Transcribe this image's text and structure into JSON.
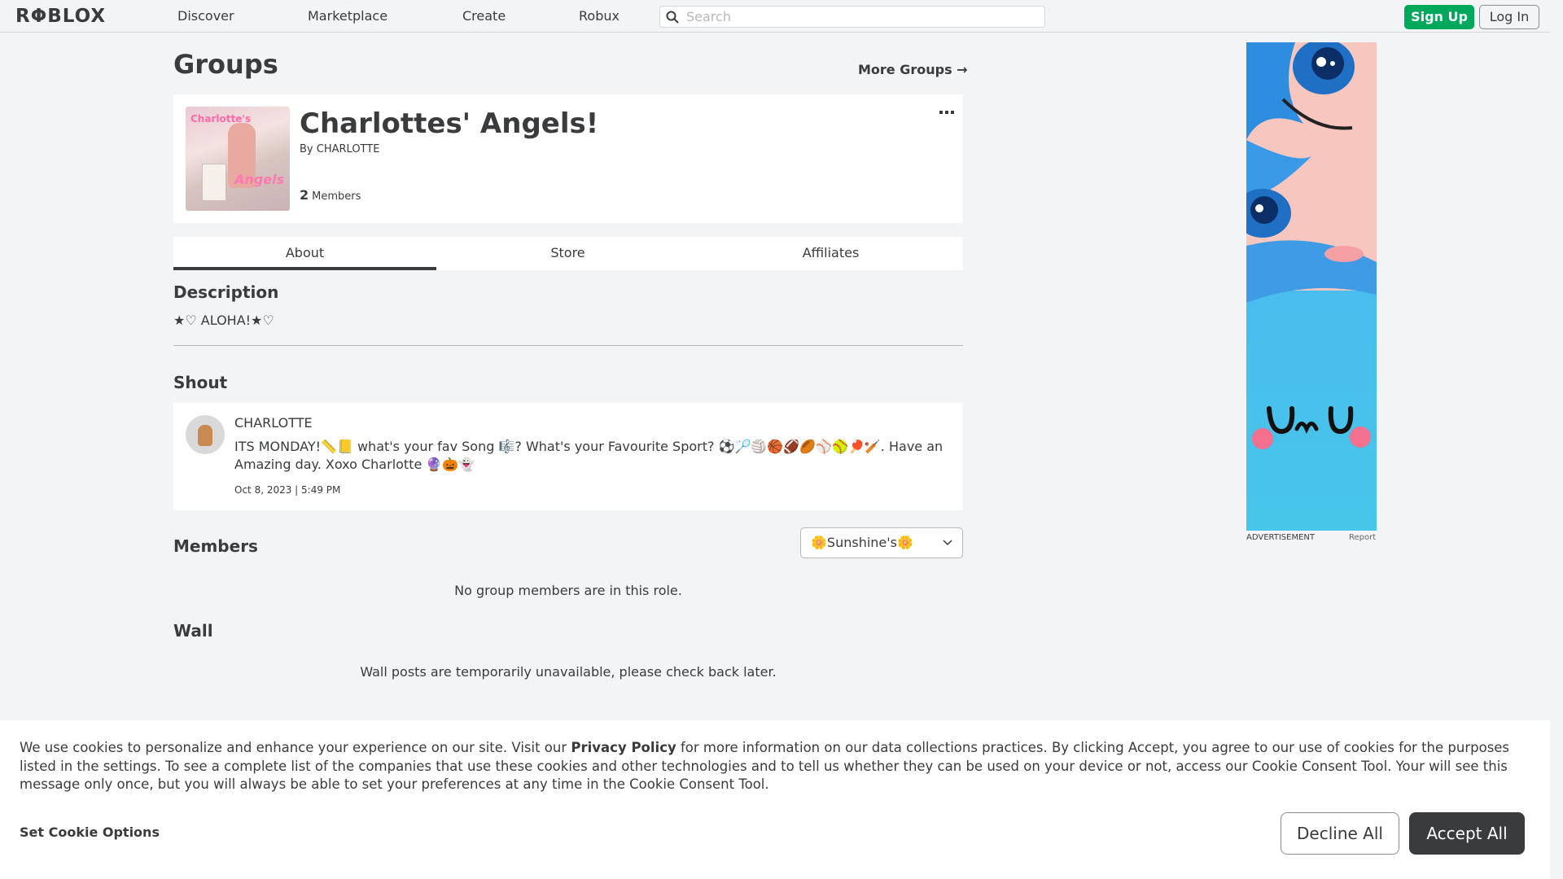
{
  "nav": {
    "logo": "RΦBLOX",
    "links": [
      "Discover",
      "Marketplace",
      "Create",
      "Robux"
    ],
    "search_placeholder": "Search",
    "signup": "Sign Up",
    "login": "Log In"
  },
  "page": {
    "title": "Groups",
    "more_groups": "More Groups →"
  },
  "group": {
    "thumb_text_top": "Charlotte's",
    "thumb_text_bottom": "Angels",
    "name": "Charlottes' Angels!",
    "by_prefix": "By",
    "owner": "CHARLOTTE",
    "member_count": "2",
    "member_label": "Members",
    "more_label": "•••"
  },
  "tabs": [
    "About",
    "Store",
    "Affiliates"
  ],
  "about": {
    "description_title": "Description",
    "description": "★♡ ALOHA!★♡",
    "shout_title": "Shout",
    "shout": {
      "author": "CHARLOTTE",
      "text": "ITS MONDAY!📏📒 what's your fav Song 🎼? What's your Favourite Sport? ⚽🏸🏐🏀🏈🏉⚾🥎🏓🏏. Have an Amazing day. Xoxo Charlotte 🔮🎃👻",
      "date": "Oct 8, 2023 | 5:49 PM"
    },
    "members_title": "Members",
    "role_selected": "🌼Sunshine's🌼",
    "members_empty": "No group members are in this role.",
    "wall_title": "Wall",
    "wall_empty": "Wall posts are temporarily unavailable, please check back later."
  },
  "ad": {
    "label": "ADVERTISEMENT",
    "report": "Report",
    "face_text": "UwU"
  },
  "cookie": {
    "text_before": "We use cookies to personalize and enhance your experience on our site. Visit our ",
    "privacy": "Privacy Policy",
    "text_after": " for more information on our data collections practices. By clicking Accept, you agree to our use of cookies for the purposes listed in the settings. To see a complete list of the companies that use these cookies and other technologies and to tell us whether they can be used on your device or not, access our Cookie Consent Tool. Your will see this message only once, but you will always be able to set your preferences at any time in the Cookie Consent Tool.",
    "set_options": "Set Cookie Options",
    "decline": "Decline All",
    "accept": "Accept All"
  }
}
